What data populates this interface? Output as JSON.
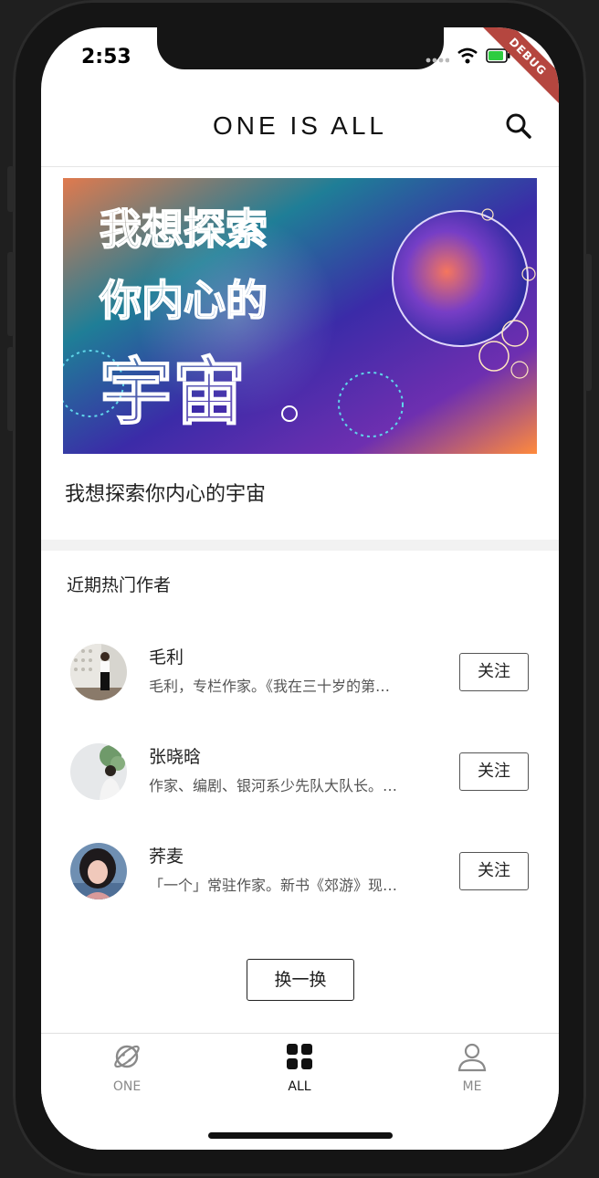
{
  "status_bar": {
    "time": "2:53",
    "debug_label": "DEBUG"
  },
  "header": {
    "title": "ONE IS ALL"
  },
  "banner": {
    "art_text": [
      "我想探索",
      "你内心的",
      "宇宙"
    ],
    "caption": "我想探索你内心的宇宙"
  },
  "authors_section": {
    "title": "近期热门作者",
    "authors": [
      {
        "name": "毛利",
        "desc": "毛利，专栏作家。《我在三十岁的第…",
        "follow_label": "关注"
      },
      {
        "name": "张晓晗",
        "desc": "作家、编剧、银河系少先队大队长。…",
        "follow_label": "关注"
      },
      {
        "name": "荞麦",
        "desc": "「一个」常驻作家。新书《郊游》现…",
        "follow_label": "关注"
      }
    ],
    "refresh_label": "换一换"
  },
  "tabbar": {
    "tabs": [
      {
        "label": "ONE",
        "icon": "planet-icon",
        "active": false
      },
      {
        "label": "ALL",
        "icon": "grid-icon",
        "active": true
      },
      {
        "label": "ME",
        "icon": "person-icon",
        "active": false
      }
    ]
  },
  "colors": {
    "active_tab": "#111111",
    "inactive_tab": "#8a8a8a",
    "debug_ribbon": "#b5463f"
  }
}
